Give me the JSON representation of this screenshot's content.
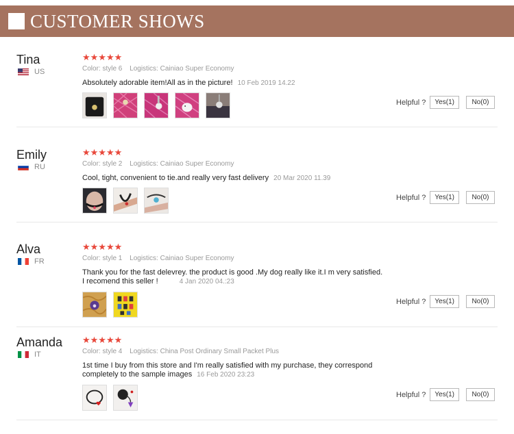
{
  "header": {
    "title": "CUSTOMER SHOWS"
  },
  "helpful_label": "Helpful ?",
  "reviews": [
    {
      "name": "Tina",
      "country": "US",
      "stars": "★★★★★",
      "color": "Color: style 6",
      "logistics": "Logistics: Cainiao Super Economy",
      "text": "Absolutely adorable item!All as in the picture!",
      "date": "10 Feb 2019 14.22",
      "yes": "Yes(1)",
      "no": "No(0)",
      "photos": [
        "black-bag-photo",
        "pink-bag-photo",
        "pink-bag-charm-photo",
        "elephant-charm-photo",
        "charm-closeup-photo"
      ]
    },
    {
      "name": "Emily",
      "country": "RU",
      "stars": "★★★★★",
      "color": "Color: style 2",
      "logistics": "Logistics: Cainiao Super Economy",
      "text": "Cool, tight, convenient to tie.and really very fast delivery",
      "date": "20 Mar 2020 11.39",
      "yes": "Yes(1)",
      "no": "No(0)",
      "photos": [
        "choker-neck-photo",
        "bracelet-wrist-photo",
        "blue-charm-bracelet-photo"
      ]
    },
    {
      "name": "Alva",
      "country": "FR",
      "stars": "★★★★★",
      "color": "Color: style 1",
      "logistics": "Logistics: Cainiao Super Economy",
      "text": "Thank you for the fast delevrey. the product is good .My dog really like it.I m very satisfied.",
      "text2": "I recomend this seller !",
      "date": "4 Jan 2020 04.:23",
      "yes": "Yes(1)",
      "no": "No(0)",
      "photos": [
        "dog-fur-paw-tag-photo",
        "yellow-card-charms-photo"
      ]
    },
    {
      "name": "Amanda",
      "country": "IT",
      "stars": "★★★★★",
      "color": "Color: style 4",
      "logistics": "Logistics: China Post Ordinary Small Packet Plus",
      "text": "1st time I buy from this store and I'm really satisfied with my purchase, they correspond",
      "text2": "completely to the sample images",
      "date": "16 Feb 2020 23:23",
      "yes": "Yes(1)",
      "no": "No(0)",
      "photos": [
        "heart-bracelet-photo",
        "purple-paw-pendant-photo"
      ]
    }
  ]
}
